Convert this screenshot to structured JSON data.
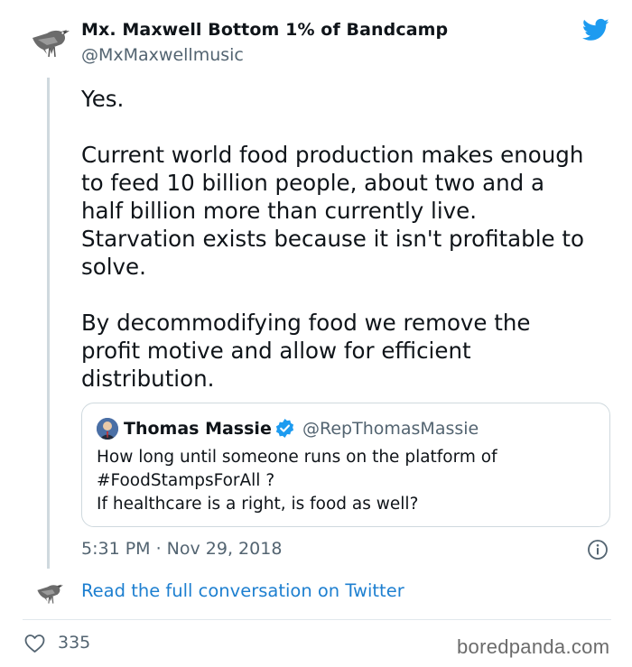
{
  "tweet": {
    "author_name": "Mx. Maxwell Bottom 1% of Bandcamp",
    "author_handle": "@MxMaxwellmusic",
    "paragraphs": [
      "Yes.",
      "Current world food production makes enough\nto feed 10 billion people, about two and a\nhalf billion more than currently live.\nStarvation exists because it isn't profitable to\nsolve.",
      "By decommodifying food we remove the\nprofit motive and allow for efficient\ndistribution."
    ],
    "timestamp": "5:31 PM · Nov 29, 2018",
    "like_count": "335"
  },
  "quoted_tweet": {
    "author_name": "Thomas Massie",
    "author_handle": "@RepThomasMassie",
    "lines": [
      "How long until someone runs on the platform of",
      "#FoodStampsForAll ?",
      "If healthcare is a right, is food as well?"
    ]
  },
  "footer": {
    "read_link": "Read the full conversation on Twitter",
    "watermark": "boredpanda.com"
  },
  "colors": {
    "twitter_blue": "#1d9bf0",
    "link_blue": "#1d7fd0",
    "secondary_text": "#536471",
    "border": "#cfd9de"
  },
  "icons": [
    "crow-avatar-icon",
    "twitter-bird-icon",
    "verified-badge-icon",
    "info-icon",
    "heart-icon"
  ]
}
